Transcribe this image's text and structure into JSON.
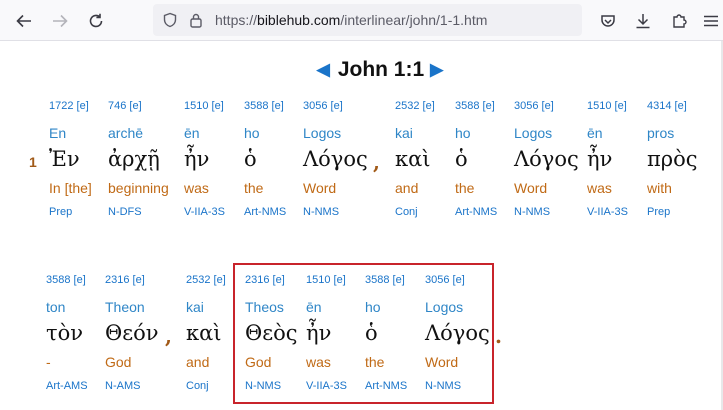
{
  "browser": {
    "url_host": "biblehub.com",
    "url_prefix": "https://",
    "url_path": "/interlinear/john/1-1.htm"
  },
  "page": {
    "title": "John 1:1",
    "verse_number": "1",
    "comma_1": ",",
    "comma_2": ",",
    "period": "."
  },
  "row1": [
    {
      "strong": "1722 [e]",
      "translit": "En",
      "greek": "Ἐν",
      "english": "In [the]",
      "pos": "Prep"
    },
    {
      "strong": "746 [e]",
      "translit": "archē",
      "greek": "ἀρχῇ",
      "english": "beginning",
      "pos": "N-DFS"
    },
    {
      "strong": "1510 [e]",
      "translit": "ēn",
      "greek": "ἦν",
      "english": "was",
      "pos": "V-IIA-3S"
    },
    {
      "strong": "3588 [e]",
      "translit": "ho",
      "greek": "ὁ",
      "english": "the",
      "pos": "Art-NMS"
    },
    {
      "strong": "3056 [e]",
      "translit": "Logos",
      "greek": "Λόγος",
      "english": "Word",
      "pos": "N-NMS"
    },
    {
      "strong": "2532 [e]",
      "translit": "kai",
      "greek": "καὶ",
      "english": "and",
      "pos": "Conj"
    },
    {
      "strong": "3588 [e]",
      "translit": "ho",
      "greek": "ὁ",
      "english": "the",
      "pos": "Art-NMS"
    },
    {
      "strong": "3056 [e]",
      "translit": "Logos",
      "greek": "Λόγος",
      "english": "Word",
      "pos": "N-NMS"
    },
    {
      "strong": "1510 [e]",
      "translit": "ēn",
      "greek": "ἦν",
      "english": "was",
      "pos": "V-IIA-3S"
    },
    {
      "strong": "4314 [e]",
      "translit": "pros",
      "greek": "πρὸς",
      "english": "with",
      "pos": "Prep"
    }
  ],
  "row2": [
    {
      "strong": "3588 [e]",
      "translit": "ton",
      "greek": "τὸν",
      "english": "-",
      "pos": "Art-AMS"
    },
    {
      "strong": "2316 [e]",
      "translit": "Theon",
      "greek": "Θεόν",
      "english": "God",
      "pos": "N-AMS"
    },
    {
      "strong": "2532 [e]",
      "translit": "kai",
      "greek": "καὶ",
      "english": "and",
      "pos": "Conj"
    },
    {
      "strong": "2316 [e]",
      "translit": "Theos",
      "greek": "Θεὸς",
      "english": "God",
      "pos": "N-NMS"
    },
    {
      "strong": "1510 [e]",
      "translit": "ēn",
      "greek": "ἦν",
      "english": "was",
      "pos": "V-IIA-3S"
    },
    {
      "strong": "3588 [e]",
      "translit": "ho",
      "greek": "ὁ",
      "english": "the",
      "pos": "Art-NMS"
    },
    {
      "strong": "3056 [e]",
      "translit": "Logos",
      "greek": "Λόγος",
      "english": "Word",
      "pos": "N-NMS"
    }
  ],
  "colors": {
    "link_blue": "#1a74c9",
    "english_orange": "#c06a16",
    "highlight_red": "#c8242b"
  }
}
